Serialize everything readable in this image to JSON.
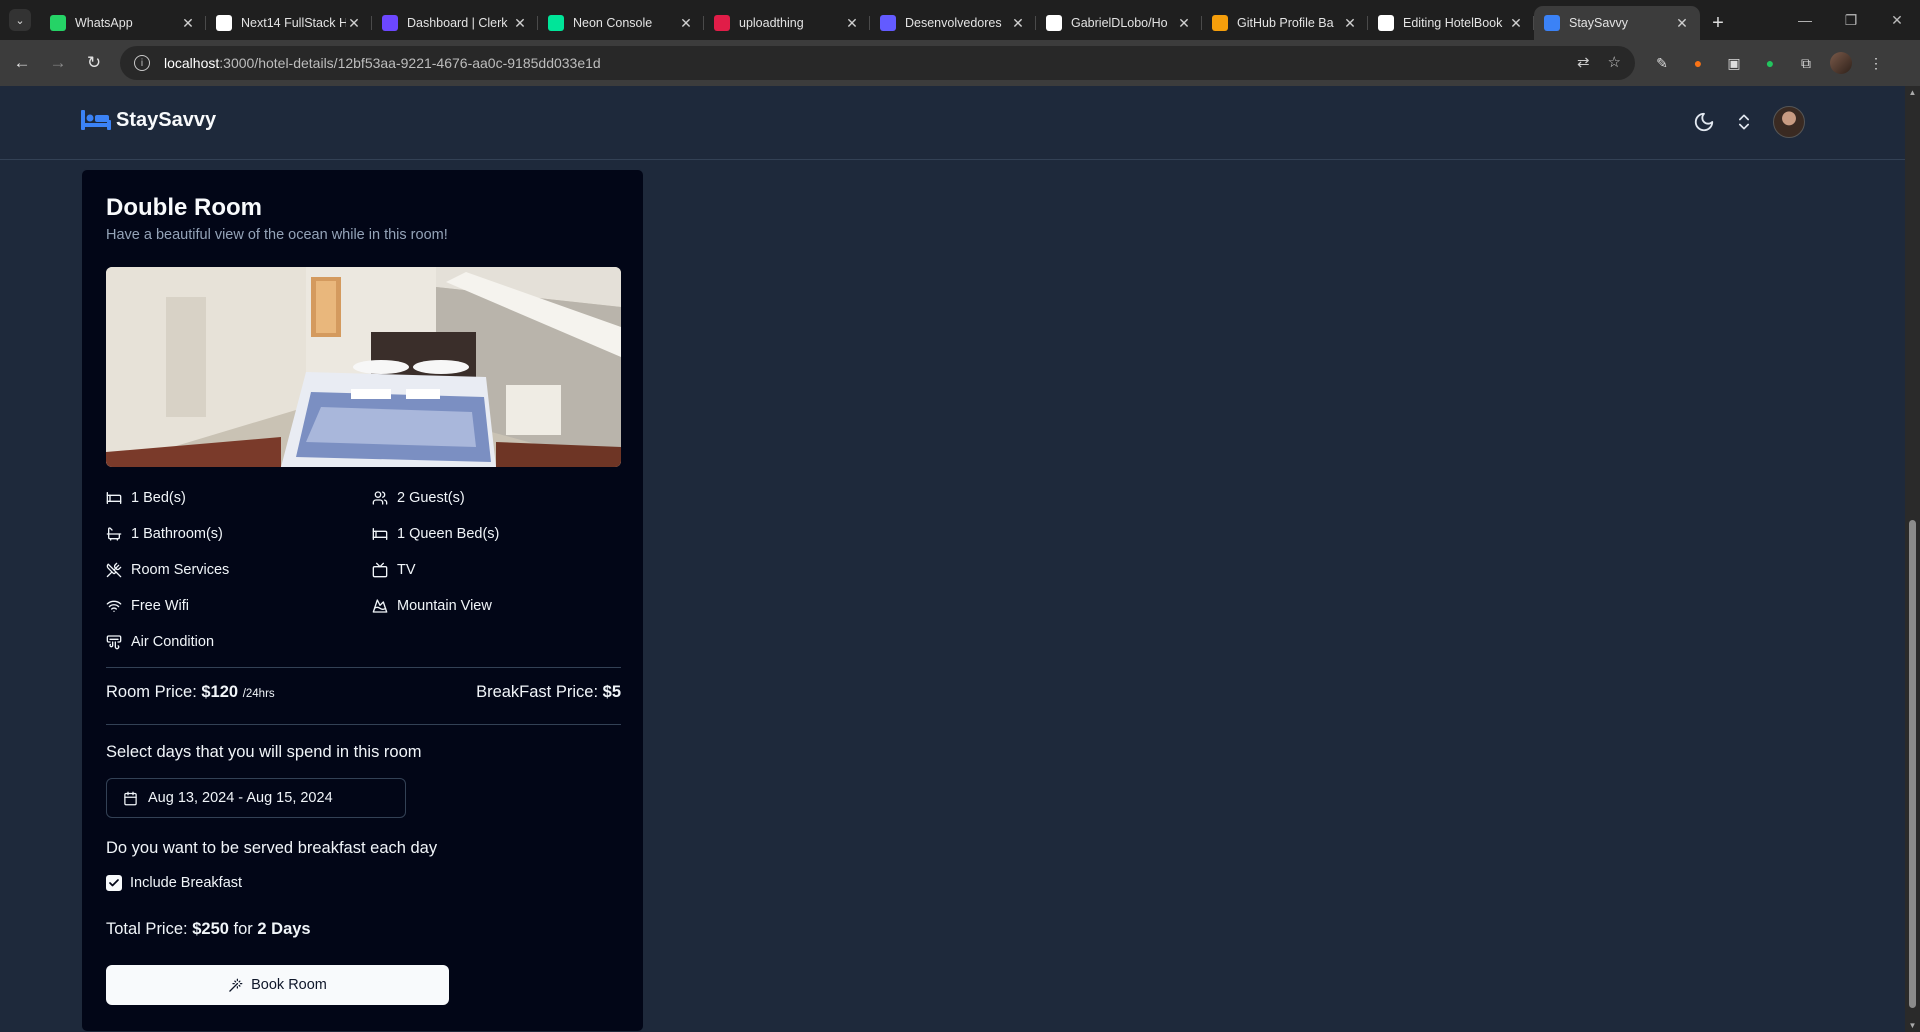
{
  "browser": {
    "tabs": [
      {
        "title": "WhatsApp",
        "fav_color": "#25d366",
        "active": false
      },
      {
        "title": "Next14 FullStack H",
        "fav_color": "#ffffff",
        "active": false
      },
      {
        "title": "Dashboard | Clerk",
        "fav_color": "#6c47ff",
        "active": false
      },
      {
        "title": "Neon Console",
        "fav_color": "#00e599",
        "active": false
      },
      {
        "title": "uploadthing",
        "fav_color": "#e11d48",
        "active": false
      },
      {
        "title": "Desenvolvedores",
        "fav_color": "#635bff",
        "active": false
      },
      {
        "title": "GabrielDLobo/Ho",
        "fav_color": "#ffffff",
        "active": false
      },
      {
        "title": "GitHub Profile Ba",
        "fav_color": "#f59e0b",
        "active": false
      },
      {
        "title": "Editing HotelBook",
        "fav_color": "#ffffff",
        "active": false
      },
      {
        "title": "StaySavvy",
        "fav_color": "#3b82f6",
        "active": true
      }
    ],
    "url_host": "localhost",
    "url_path": ":3000/hotel-details/12bf53aa-9221-4676-aa0c-9185dd033e1d"
  },
  "app": {
    "brand": "StaySavvy",
    "accent": "#3b82f6"
  },
  "room": {
    "title": "Double Room",
    "description": "Have a beautiful view of the ocean while in this room!",
    "amenities": [
      {
        "label": "1 Bed(s)",
        "icon": "bed-icon"
      },
      {
        "label": "2 Guest(s)",
        "icon": "users-icon"
      },
      {
        "label": "1 Bathroom(s)",
        "icon": "bath-icon"
      },
      {
        "label": "1 Queen Bed(s)",
        "icon": "bed-icon"
      },
      {
        "label": "Room Services",
        "icon": "utensils-icon"
      },
      {
        "label": "TV",
        "icon": "tv-icon"
      },
      {
        "label": "Free Wifi",
        "icon": "wifi-icon"
      },
      {
        "label": "Mountain View",
        "icon": "mountain-icon"
      },
      {
        "label": "Air Condition",
        "icon": "air-vent-icon"
      }
    ],
    "room_price_label": "Room Price:",
    "room_price_value": "$120",
    "room_price_unit": "/24hrs",
    "breakfast_price_label": "BreakFast Price:",
    "breakfast_price_value": "$5",
    "select_days_label": "Select days that you will spend in this room",
    "date_range": "Aug 13, 2024 - Aug 15, 2024",
    "breakfast_question": "Do you want to be served breakfast each day",
    "include_breakfast_label": "Include Breakfast",
    "include_breakfast_checked": true,
    "total_label": "Total Price:",
    "total_value": "$250",
    "total_for": "for",
    "total_days": "2 Days",
    "book_button": "Book Room"
  }
}
